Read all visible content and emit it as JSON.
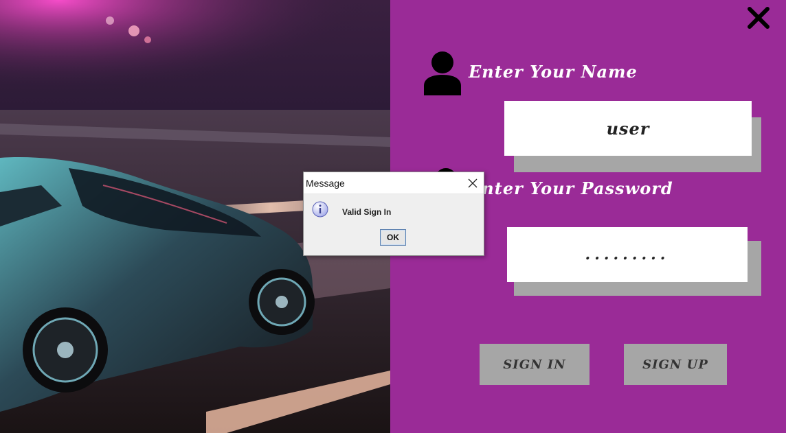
{
  "window": {
    "close_icon": "close-x-icon"
  },
  "form": {
    "name_label": "Enter Your Name",
    "name_value": "user",
    "password_label": "Enter Your Password",
    "password_value": ".........",
    "sign_in_label": "SIGN IN",
    "sign_up_label": "SIGN UP"
  },
  "dialog": {
    "title": "Message",
    "message": "Valid Sign In",
    "ok_label": "OK",
    "icon": "info-icon"
  },
  "colors": {
    "panel_bg": "#9a2b97",
    "field_bg": "#ffffff",
    "shadow": "#a6a6a6",
    "button_bg": "#a6a6a6"
  }
}
